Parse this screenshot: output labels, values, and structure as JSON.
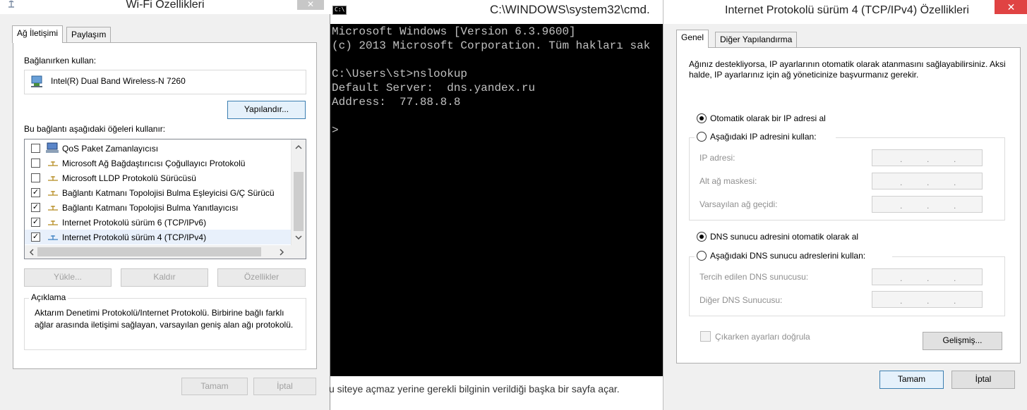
{
  "wifi": {
    "title": "Wi-Fi Özellikleri",
    "close_symbol": "✕",
    "tabs": [
      {
        "label": "Ağ İletişimi"
      },
      {
        "label": "Paylaşım"
      }
    ],
    "connect_using_label": "Bağlanırken kullan:",
    "adapter_name": "Intel(R) Dual Band Wireless-N 7260",
    "configure_button": "Yapılandır...",
    "items_label": "Bu bağlantı aşağıdaki öğeleri kullanır:",
    "items": [
      {
        "label": "QoS Paket Zamanlayıcısı",
        "checked": false,
        "icon": "qos-icon"
      },
      {
        "label": "Microsoft Ağ Bağdaştırıcısı Çoğullayıcı Protokolü",
        "checked": false,
        "icon": "protocol-icon"
      },
      {
        "label": "Microsoft LLDP Protokolü Sürücüsü",
        "checked": false,
        "icon": "protocol-icon"
      },
      {
        "label": "Bağlantı Katmanı Topolojisi Bulma Eşleyicisi G/Ç Sürücü",
        "checked": true,
        "icon": "protocol-icon"
      },
      {
        "label": "Bağlantı Katmanı Topolojisi Bulma Yanıtlayıcısı",
        "checked": true,
        "icon": "protocol-icon"
      },
      {
        "label": "Internet Protokolü sürüm 6 (TCP/IPv6)",
        "checked": true,
        "icon": "protocol-icon"
      },
      {
        "label": "Internet Protokolü sürüm 4 (TCP/IPv4)",
        "checked": true,
        "icon": "protocol-icon"
      }
    ],
    "install_button": "Yükle...",
    "uninstall_button": "Kaldır",
    "properties_button": "Özellikler",
    "description_title": "Açıklama",
    "description_text": "Aktarım Denetimi Protokolü/Internet Protokolü. Birbirine bağlı farklı ağlar arasında iletişimi sağlayan, varsayılan geniş alan ağı protokolü.",
    "ok_button": "Tamam",
    "cancel_button": "İptal"
  },
  "cmd": {
    "title": "C:\\WINDOWS\\system32\\cmd.",
    "icon_text": "C:\\",
    "lines": [
      "Microsoft Windows [Version 6.3.9600]",
      "(c) 2013 Microsoft Corporation. Tüm hakları sak",
      "",
      "C:\\Users\\st>nslookup",
      "Default Server:  dns.yandex.ru",
      "Address:  77.88.8.8",
      "",
      ">"
    ],
    "background_text": "u siteye açmaz yerine gerekli bilginin verildiği başka bir sayfa açar."
  },
  "ipv4": {
    "title": "Internet Protokolü sürüm 4 (TCP/IPv4) Özellikleri",
    "close_symbol": "✕",
    "tabs": [
      {
        "label": "Genel"
      },
      {
        "label": "Diğer Yapılandırma"
      }
    ],
    "intro_text": "Ağınız destekliyorsa, IP ayarlarının otomatik olarak atanmasını sağlayabilirsiniz. Aksi halde, IP ayarlarınız için ağ yöneticinize başvurmanız gerekir.",
    "auto_ip_label": "Otomatik olarak bir IP adresi al",
    "manual_ip_label": "Aşağıdaki IP adresini kullan:",
    "ip_address_label": "IP adresi:",
    "subnet_mask_label": "Alt ağ maskesi:",
    "gateway_label": "Varsayılan ağ geçidi:",
    "auto_dns_label": "DNS sunucu adresini otomatik olarak al",
    "manual_dns_label": "Aşağıdaki DNS sunucu adreslerini kullan:",
    "preferred_dns_label": "Tercih edilen DNS sunucusu:",
    "alternate_dns_label": "Diğer DNS Sunucusu:",
    "validate_label": "Çıkarken ayarları doğrula",
    "advanced_button": "Gelişmiş...",
    "ok_button": "Tamam",
    "cancel_button": "İptal",
    "ip_dot": "."
  }
}
